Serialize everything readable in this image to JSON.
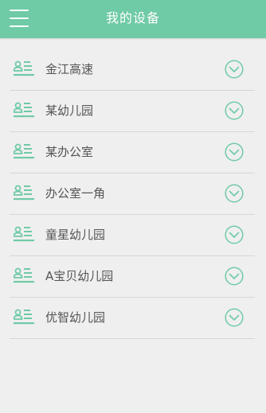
{
  "header": {
    "title": "我的设备",
    "menu_icon": "hamburger-menu-icon",
    "background_color": "#6fcaa6"
  },
  "accent_color": "#6fcaa6",
  "devices": [
    {
      "name": "金江高速",
      "icon": "device-card-icon",
      "action_icon": "chevron-down-circle-icon"
    },
    {
      "name": "某幼儿园",
      "icon": "device-card-icon",
      "action_icon": "chevron-down-circle-icon"
    },
    {
      "name": "某办公室",
      "icon": "device-card-icon",
      "action_icon": "chevron-down-circle-icon"
    },
    {
      "name": "办公室一角",
      "icon": "device-card-icon",
      "action_icon": "chevron-down-circle-icon"
    },
    {
      "name": "童星幼儿园",
      "icon": "device-card-icon",
      "action_icon": "chevron-down-circle-icon"
    },
    {
      "name": "A宝贝幼儿园",
      "icon": "device-card-icon",
      "action_icon": "chevron-down-circle-icon"
    },
    {
      "name": "优智幼儿园",
      "icon": "device-card-icon",
      "action_icon": "chevron-down-circle-icon"
    }
  ]
}
